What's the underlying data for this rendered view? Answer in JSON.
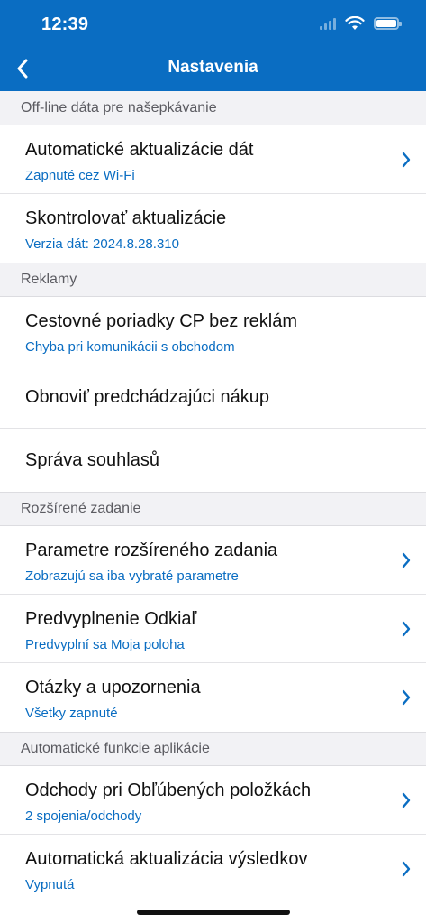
{
  "status_bar": {
    "time": "12:39"
  },
  "nav": {
    "title": "Nastavenia"
  },
  "sections": [
    {
      "header": "Off-line dáta pre našepkávanie",
      "rows": [
        {
          "title": "Automatické aktualizácie dát",
          "subtitle": "Zapnuté cez Wi-Fi",
          "chevron": true
        },
        {
          "title": "Skontrolovať aktualizácie",
          "subtitle": "Verzia dát: 2024.8.28.310",
          "chevron": false
        }
      ]
    },
    {
      "header": "Reklamy",
      "rows": [
        {
          "title": "Cestovné poriadky CP bez reklám",
          "subtitle": "Chyba pri komunikácii s obchodom",
          "chevron": false
        },
        {
          "title": "Obnoviť predchádzajúci nákup",
          "chevron": false
        },
        {
          "title": "Správa souhlasů",
          "chevron": false
        }
      ]
    },
    {
      "header": "Rozšírené zadanie",
      "rows": [
        {
          "title": "Parametre rozšíreného zadania",
          "subtitle": "Zobrazujú sa iba vybraté parametre",
          "chevron": true
        },
        {
          "title": "Predvyplnenie Odkiaľ",
          "subtitle": "Predvyplní sa Moja poloha",
          "chevron": true
        },
        {
          "title": "Otázky a upozornenia",
          "subtitle": "Všetky zapnuté",
          "chevron": true
        }
      ]
    },
    {
      "header": "Automatické funkcie aplikácie",
      "rows": [
        {
          "title": "Odchody pri Obľúbených položkách",
          "subtitle": "2 spojenia/odchody",
          "chevron": true
        },
        {
          "title": "Automatická aktualizácia výsledkov",
          "subtitle": "Vypnutá",
          "chevron": true
        }
      ]
    }
  ],
  "colors": {
    "accent": "#0a6dc2",
    "section_bg": "#f2f2f5"
  }
}
